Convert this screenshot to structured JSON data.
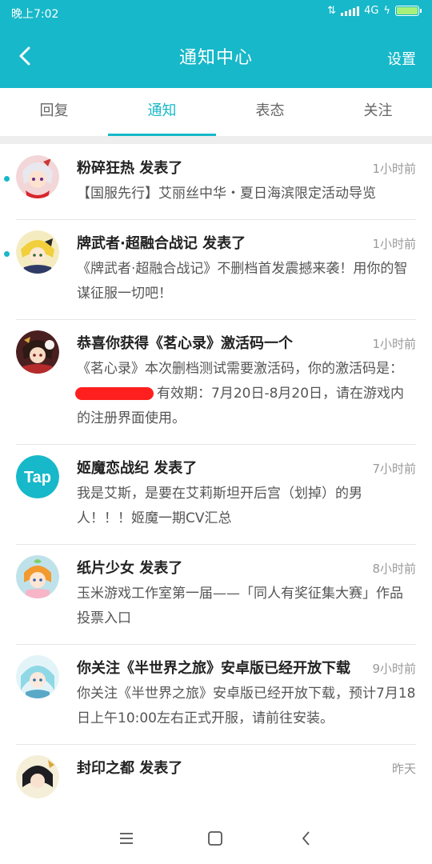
{
  "status_bar": {
    "time": "晚上7:02",
    "network": "4G",
    "battery_level": 1.0
  },
  "header": {
    "title": "通知中心",
    "settings_label": "设置",
    "back_icon": "chevron-left-icon",
    "color": "#17b8c9"
  },
  "tabs": [
    {
      "label": "回复",
      "active": false
    },
    {
      "label": "通知",
      "active": true
    },
    {
      "label": "表态",
      "active": false
    },
    {
      "label": "关注",
      "active": false
    }
  ],
  "notifications": [
    {
      "title": "粉碎狂热 发表了",
      "time": "1小时前",
      "body": "【国服先行】艾丽丝中华・夏日海滨限定活动导览",
      "unread": true
    },
    {
      "title": "牌武者·超融合战记 发表了",
      "time": "1小时前",
      "body": "《牌武者·超融合战记》不删档首发震撼来袭！用你的智谋征服一切吧！",
      "unread": true
    },
    {
      "title": "恭喜你获得《茗心录》激活码一个",
      "time": "1小时前",
      "body_before": "《茗心录》本次删档测试需要激活码，你的激活码是：",
      "body_after": "有效期：7月20日-8月20日，请在游戏内的注册界面使用。",
      "unread": false
    },
    {
      "title": "姬魔恋战纪 发表了",
      "time": "7小时前",
      "body": "我是艾斯，是要在艾莉斯坦开后宫（划掉）的男人！！！姬魔一期CV汇总",
      "avatar_text": "Tap",
      "unread": false
    },
    {
      "title": "纸片少女 发表了",
      "time": "8小时前",
      "body": "玉米游戏工作室第一届——「同人有奖征集大赛」作品投票入口",
      "unread": false
    },
    {
      "title": "你关注《半世界之旅》安卓版已经开放下载",
      "time": "9小时前",
      "body": "你关注《半世界之旅》安卓版已经开放下载，预计7月18日上午10:00左右正式开服，请前往安装。",
      "unread": false
    },
    {
      "title": "封印之都 发表了",
      "time": "昨天",
      "body": "",
      "unread": false
    }
  ]
}
